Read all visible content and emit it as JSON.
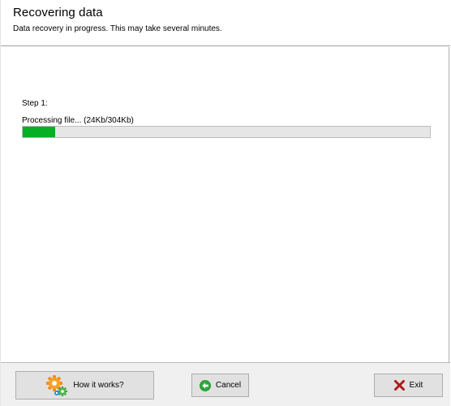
{
  "header": {
    "title": "Recovering data",
    "subtitle": "Data recovery in progress. This may take several minutes."
  },
  "main": {
    "step_label": "Step 1:",
    "processing_label": "Processing file... (24Kb/304Kb)",
    "progress": {
      "fraction": 0.079,
      "color": "#06b025"
    }
  },
  "footer": {
    "how_label": "How it works?",
    "how_icon": "gears-icon",
    "cancel_label": "Cancel",
    "cancel_icon": "back-arrow-icon",
    "exit_label": "Exit",
    "exit_icon": "red-x-icon"
  }
}
